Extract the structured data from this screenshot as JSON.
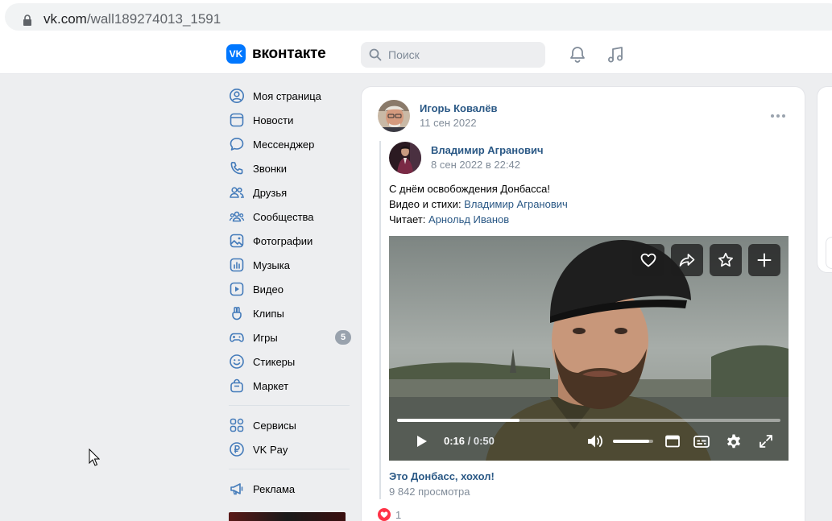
{
  "browser": {
    "url_domain": "vk.com",
    "url_path": "/wall189274013_1591"
  },
  "header": {
    "logo_text": "вконтакте",
    "logo_mark": "VK",
    "search_placeholder": "Поиск"
  },
  "menu": {
    "items": [
      {
        "label": "Моя страница",
        "icon": "user-circle-icon"
      },
      {
        "label": "Новости",
        "icon": "news-icon"
      },
      {
        "label": "Мессенджер",
        "icon": "message-icon"
      },
      {
        "label": "Звонки",
        "icon": "phone-icon"
      },
      {
        "label": "Друзья",
        "icon": "friends-icon"
      },
      {
        "label": "Сообщества",
        "icon": "communities-icon"
      },
      {
        "label": "Фотографии",
        "icon": "photo-icon"
      },
      {
        "label": "Музыка",
        "icon": "music-icon"
      },
      {
        "label": "Видео",
        "icon": "video-icon"
      },
      {
        "label": "Клипы",
        "icon": "clips-icon"
      },
      {
        "label": "Игры",
        "icon": "gamepad-icon",
        "badge": "5"
      },
      {
        "label": "Стикеры",
        "icon": "smile-icon"
      },
      {
        "label": "Маркет",
        "icon": "bag-icon"
      }
    ],
    "secondary": [
      {
        "label": "Сервисы",
        "icon": "services-icon"
      },
      {
        "label": "VK Pay",
        "icon": "vkpay-icon"
      }
    ],
    "tertiary": [
      {
        "label": "Реклама",
        "icon": "megaphone-icon"
      }
    ]
  },
  "post": {
    "author": "Игорь Ковалёв",
    "date": "11 сен 2022",
    "repost": {
      "author": "Владимир Агранович",
      "date": "8 сен 2022 в 22:42",
      "line1": "С днём освобождения Донбасса!",
      "line2_prefix": "Видео и стихи: ",
      "line2_link": "Владимир Агранович",
      "line3_prefix": "Читает: ",
      "line3_link": "Арнольд Иванов"
    },
    "video": {
      "current_time": "0:16",
      "separator": " / ",
      "total_time": "0:50",
      "progress": 0.32,
      "volume": 0.9,
      "title": "Это Донбасс, хохол!",
      "views": "9 842 просмотра"
    },
    "likes": "1"
  },
  "colors": {
    "accent": "#0077ff",
    "link": "#2a5885",
    "like": "#ff3347"
  }
}
